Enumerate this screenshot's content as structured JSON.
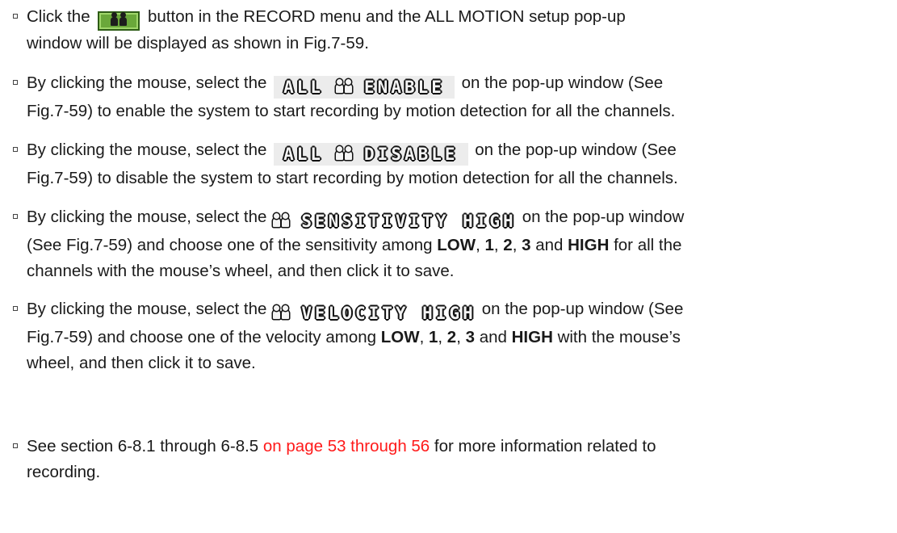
{
  "items": [
    {
      "before": "Click the",
      "after": " button in the RECORD menu and the ALL MOTION setup pop-up",
      "line2": "window will be displayed as shown in Fig.7-59.",
      "button_icon": "motion-record-button-icon"
    },
    {
      "before": "By clicking the mouse, select the",
      "osd_left": "ALL",
      "osd_right": "ENABLE",
      "after": "on the pop-up window (See",
      "line2": "Fig.7-59) to enable the system to start recording by motion detection for all the channels."
    },
    {
      "before": "By clicking the mouse, select the",
      "osd_left": "ALL",
      "osd_right": "DISABLE",
      "after": "on the pop-up window (See",
      "line2": "Fig.7-59) to disable the system to start recording by motion detection for all the channels."
    },
    {
      "before": "By clicking the mouse, select the",
      "osd_text": "SENSITIVITY HIGH",
      "after": "on the pop-up window",
      "line2_a": "(See Fig.7-59) and choose one of the sensitivity among ",
      "low": "LOW",
      "one": "1",
      "two": "2",
      "three": "3",
      "high": "HIGH",
      "line2_b": " for all the",
      "line3": "channels with the mouse’s wheel, and then click it to save."
    },
    {
      "before": "By clicking the mouse, select the",
      "osd_text": "VELOCITY HIGH",
      "after": "on the pop-up window (See",
      "line2_a": "Fig.7-59) and choose one of the velocity among ",
      "low": "LOW",
      "one": "1",
      "two": "2",
      "three": "3",
      "high": "HIGH",
      "line2_b": " with the mouse’s",
      "line3": "wheel, and then click it to save."
    },
    {
      "before": "See section 6-8.1 through 6-8.5 ",
      "link": "on page 53 through 56",
      "after": " for more information related to",
      "line2": "recording."
    }
  ],
  "colors": {
    "link_red": "#ff1a1a",
    "button_green": "#6aa83a"
  }
}
